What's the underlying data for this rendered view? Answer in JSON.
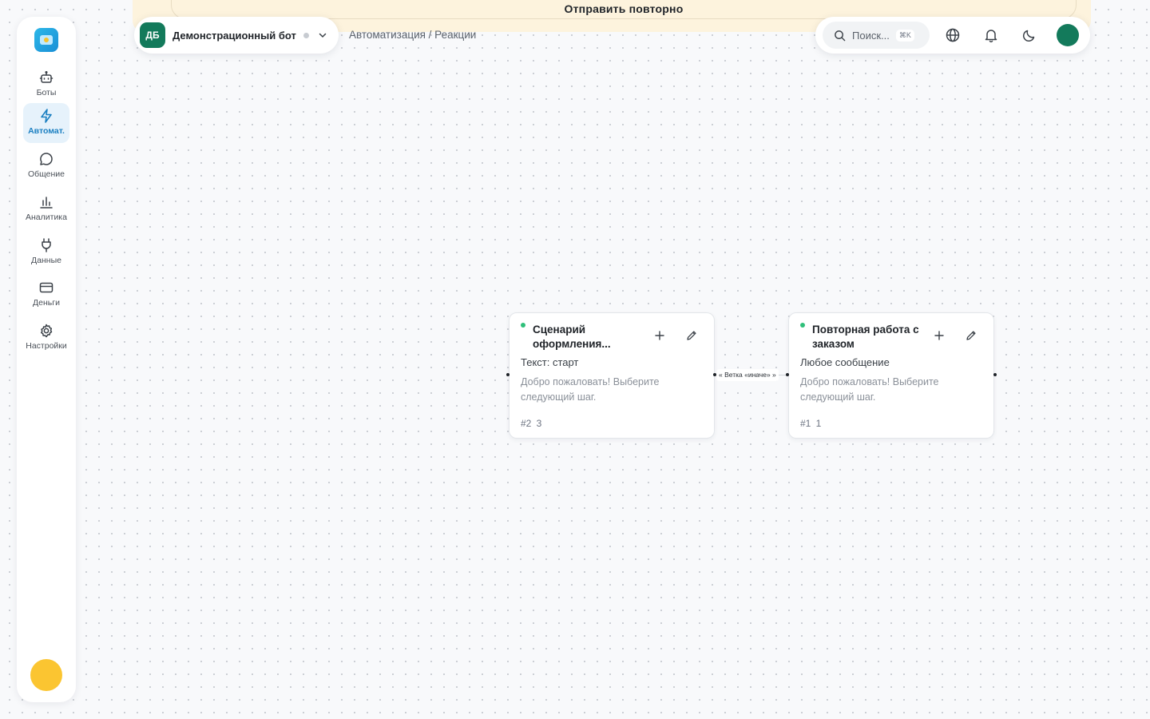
{
  "banner": {
    "resend_label": "Отправить повторно"
  },
  "sidebar": {
    "items": [
      {
        "label": "Боты",
        "icon": "bot-icon"
      },
      {
        "label": "Автомат.",
        "icon": "lightning-icon",
        "active": true
      },
      {
        "label": "Общение",
        "icon": "chat-icon"
      },
      {
        "label": "Аналитика",
        "icon": "bar-chart-icon"
      },
      {
        "label": "Данные",
        "icon": "plug-icon"
      },
      {
        "label": "Деньги",
        "icon": "credit-card-icon"
      },
      {
        "label": "Настройки",
        "icon": "gear-icon"
      }
    ]
  },
  "bot": {
    "initials": "ДБ",
    "name": "Демонстрационный бот"
  },
  "breadcrumb": "Автоматизация / Реакции",
  "search": {
    "placeholder": "Поиск...",
    "shortcut": "⌘K"
  },
  "nodes": [
    {
      "title": "Сценарий оформления...",
      "trigger": "Текст: старт",
      "message": "Добро пожаловать! Выберите следующий шаг.",
      "meta": "#2 3"
    },
    {
      "title": "Повторная работа с заказом",
      "trigger": "Любое сообщение",
      "message": "Добро пожаловать! Выберите следующий шаг.",
      "meta": "#1 1"
    }
  ],
  "edge": {
    "label": "« Ветка «иначе» »"
  },
  "colors": {
    "accent": "#1a7fc1",
    "brand_green": "#137a5b",
    "status_green": "#2fbf7a",
    "banner_bg": "#fdf3dd",
    "user_avatar": "#fbc531"
  }
}
